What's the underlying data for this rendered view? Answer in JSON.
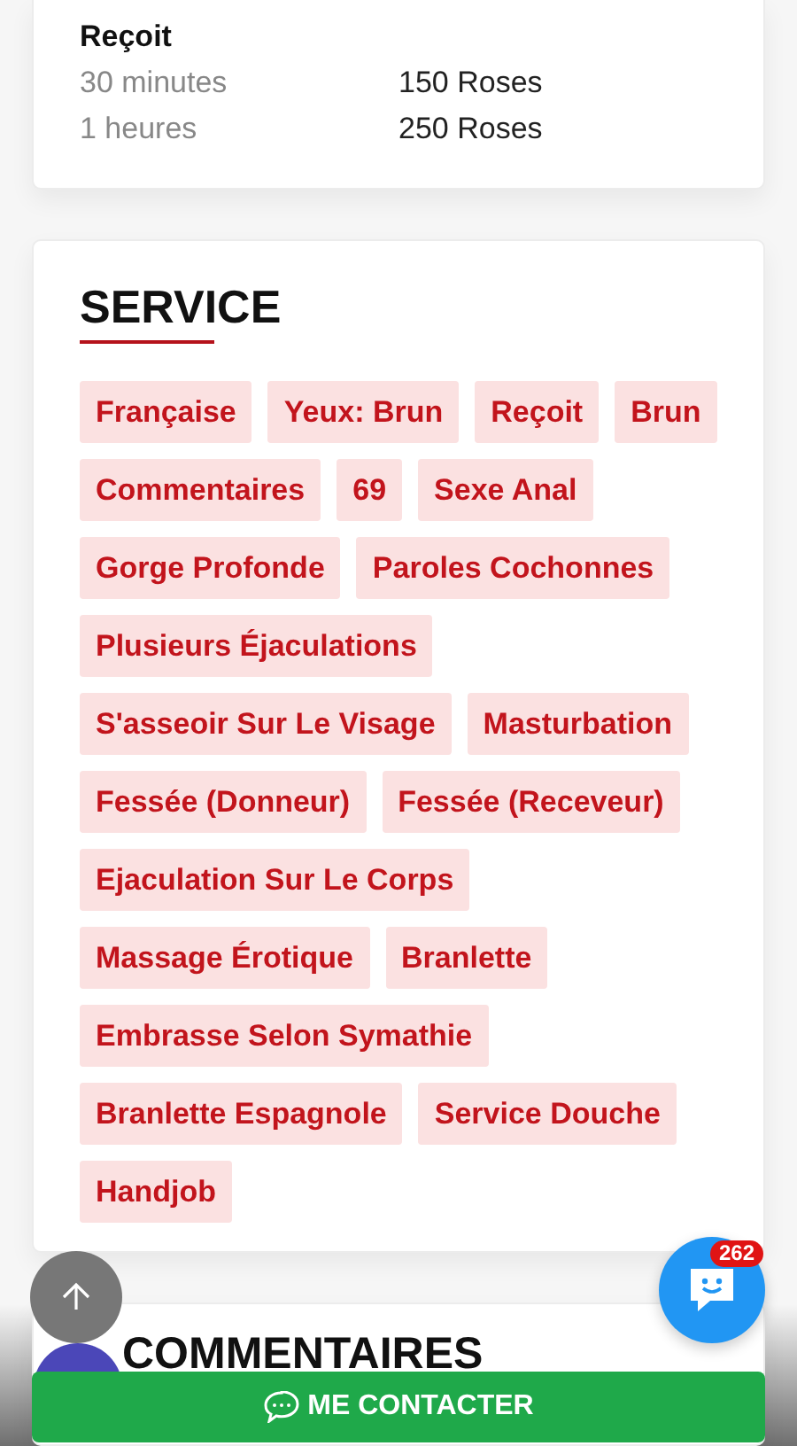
{
  "rates": {
    "title": "Reçoit",
    "rows": [
      {
        "duration": "30 minutes",
        "price": "150 Roses"
      },
      {
        "duration": "1 heures",
        "price": "250 Roses"
      }
    ]
  },
  "service": {
    "title": "SERVICE",
    "tags": [
      "Française",
      "Yeux: Brun",
      "Reçoit",
      "Brun",
      "Commentaires",
      "69",
      "Sexe Anal",
      "Gorge Profonde",
      "Paroles Cochonnes",
      "Plusieurs Éjaculations",
      "S'asseoir Sur Le Visage",
      "Masturbation",
      "Fessée (Donneur)",
      "Fessée (Receveur)",
      "Ejaculation Sur Le Corps",
      "Massage Érotique",
      "Branlette",
      "Embrasse Selon Symathie",
      "Branlette Espagnole",
      "Service Douche",
      "Handjob"
    ]
  },
  "comments": {
    "title": "COMMENTAIRES"
  },
  "chat": {
    "badge": "262"
  },
  "contact_button": {
    "label": "ME CONTACTER"
  }
}
